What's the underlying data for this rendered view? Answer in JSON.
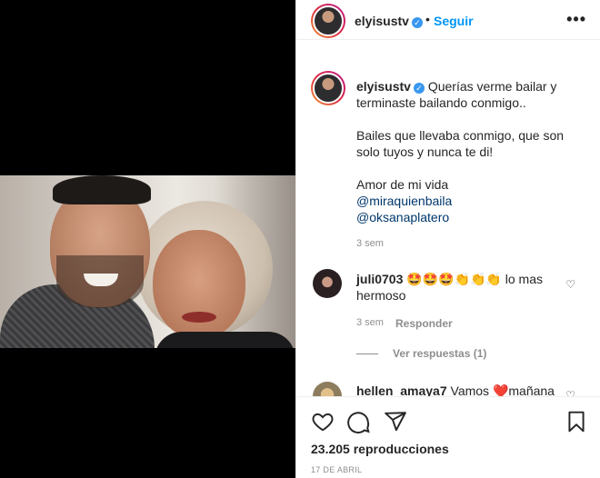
{
  "header": {
    "username": "elyisustv",
    "dot": "•",
    "follow_label": "Seguir",
    "more_label": "•••"
  },
  "caption": {
    "username": "elyisustv",
    "line1": "Querías verme bailar y terminaste bailando conmigo..",
    "line2": "Bailes que llevaba conmigo, que son solo tuyos y nunca te di!",
    "line3": "Amor de mi vida",
    "mention1": "@miraquienbaila",
    "mention2": "@oksanaplatero",
    "time": "3 sem"
  },
  "comment1": {
    "username": "juli0703",
    "text": "🤩🤩🤩👏👏👏 lo mas hermoso",
    "time": "3 sem",
    "reply_label": "Responder",
    "view_replies": "Ver respuestas (1)"
  },
  "comment2": {
    "username": "hellen_amaya7",
    "text": "Vamos ❤️mañana"
  },
  "stats": {
    "views": "23.205",
    "views_label": "reproducciones",
    "date": "17 DE ABRIL"
  },
  "icons": {
    "like": "heart-icon",
    "comment": "comment-icon",
    "share": "paper-plane-icon",
    "save": "bookmark-icon",
    "verified": "verified-badge-icon"
  },
  "colors": {
    "accent": "#0095f6",
    "verified": "#3897f0",
    "muted": "#8e8e8e",
    "text": "#262626"
  }
}
